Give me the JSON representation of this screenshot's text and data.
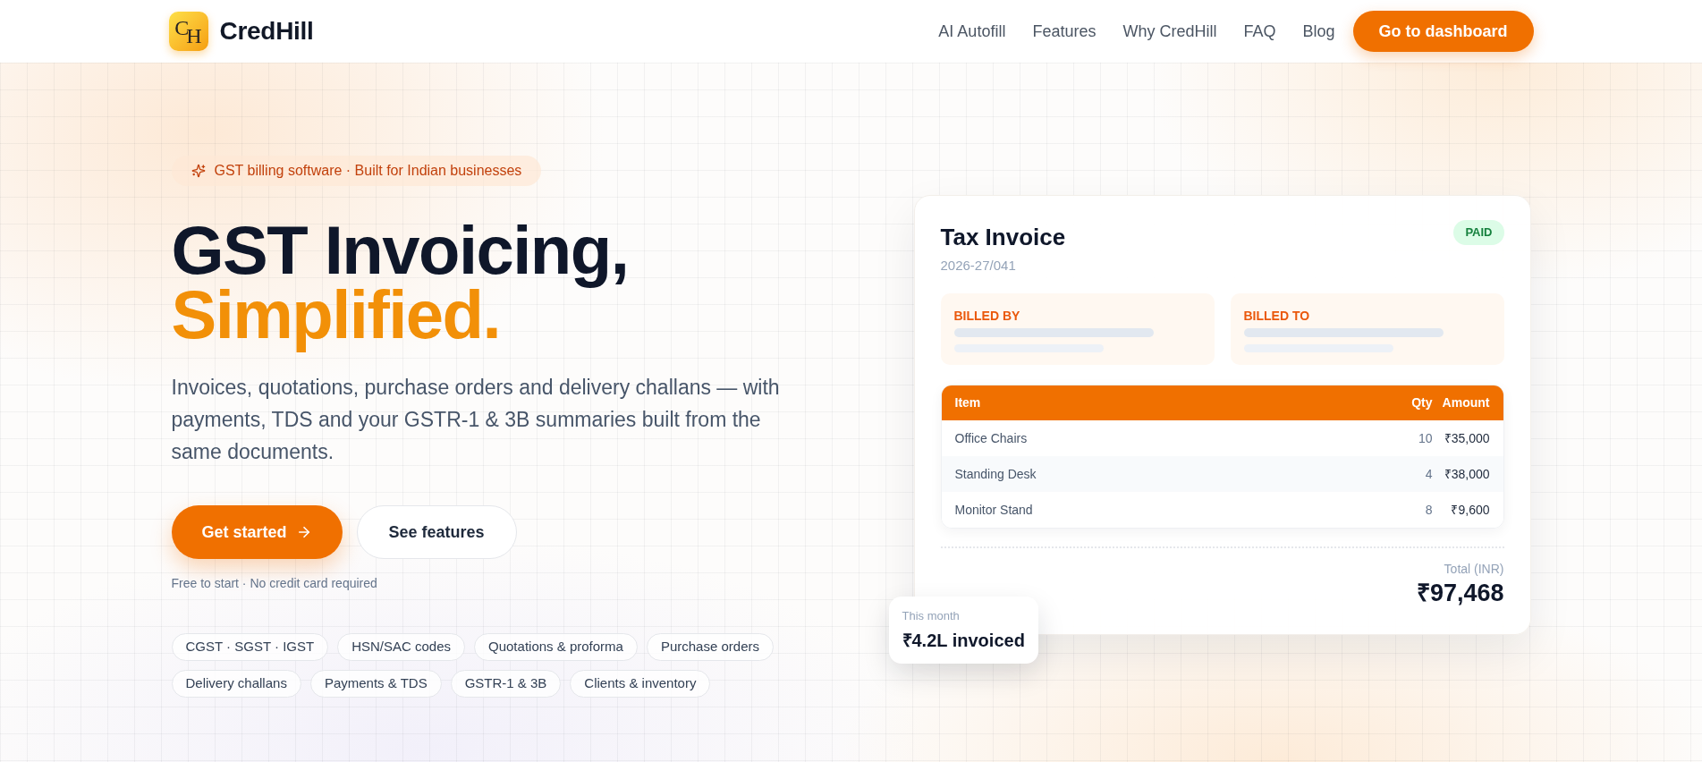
{
  "header": {
    "logo_monogram": "CH",
    "brand": "CredHill",
    "nav_links": [
      "AI Autofill",
      "Features",
      "Why CredHill",
      "FAQ",
      "Blog"
    ],
    "cta": "Go to dashboard"
  },
  "hero": {
    "badge": "GST billing software · Built for Indian businesses",
    "title": {
      "line_1": "GST Invoicing,",
      "line_2": "Simplified."
    },
    "description": "Invoices, quotations, purchase orders and delivery challans — with payments, TDS and your GSTR-1 & 3B summaries built from the same documents.",
    "buttons": [
      {
        "label": "Get started",
        "kind": "primary"
      },
      {
        "label": "See features",
        "kind": "secondary"
      }
    ],
    "note": "Free to start · No credit card required",
    "tags": [
      "CGST · SGST · IGST",
      "HSN/SAC codes",
      "Quotations & proforma",
      "Purchase orders",
      "Delivery challans",
      "Payments & TDS",
      "GSTR-1 & 3B",
      "Clients & inventory"
    ]
  },
  "invoice_card": {
    "title": "Tax Invoice",
    "status": "PAID",
    "number": "2026-27/041",
    "parties": [
      "BILLED BY",
      "BILLED TO"
    ],
    "table": {
      "columns": [
        "Item",
        "Qty",
        "Amount"
      ],
      "rows": [
        [
          "Office Chairs",
          "10",
          "₹35,000"
        ],
        [
          "Standing Desk",
          "4",
          "₹38,000"
        ],
        [
          "Monitor Stand",
          "8",
          "₹9,600"
        ]
      ]
    },
    "total_label": "Total (INR)",
    "total": "₹97,468"
  },
  "stat_card": {
    "label": "This month",
    "value": "₹4.2L invoiced"
  }
}
